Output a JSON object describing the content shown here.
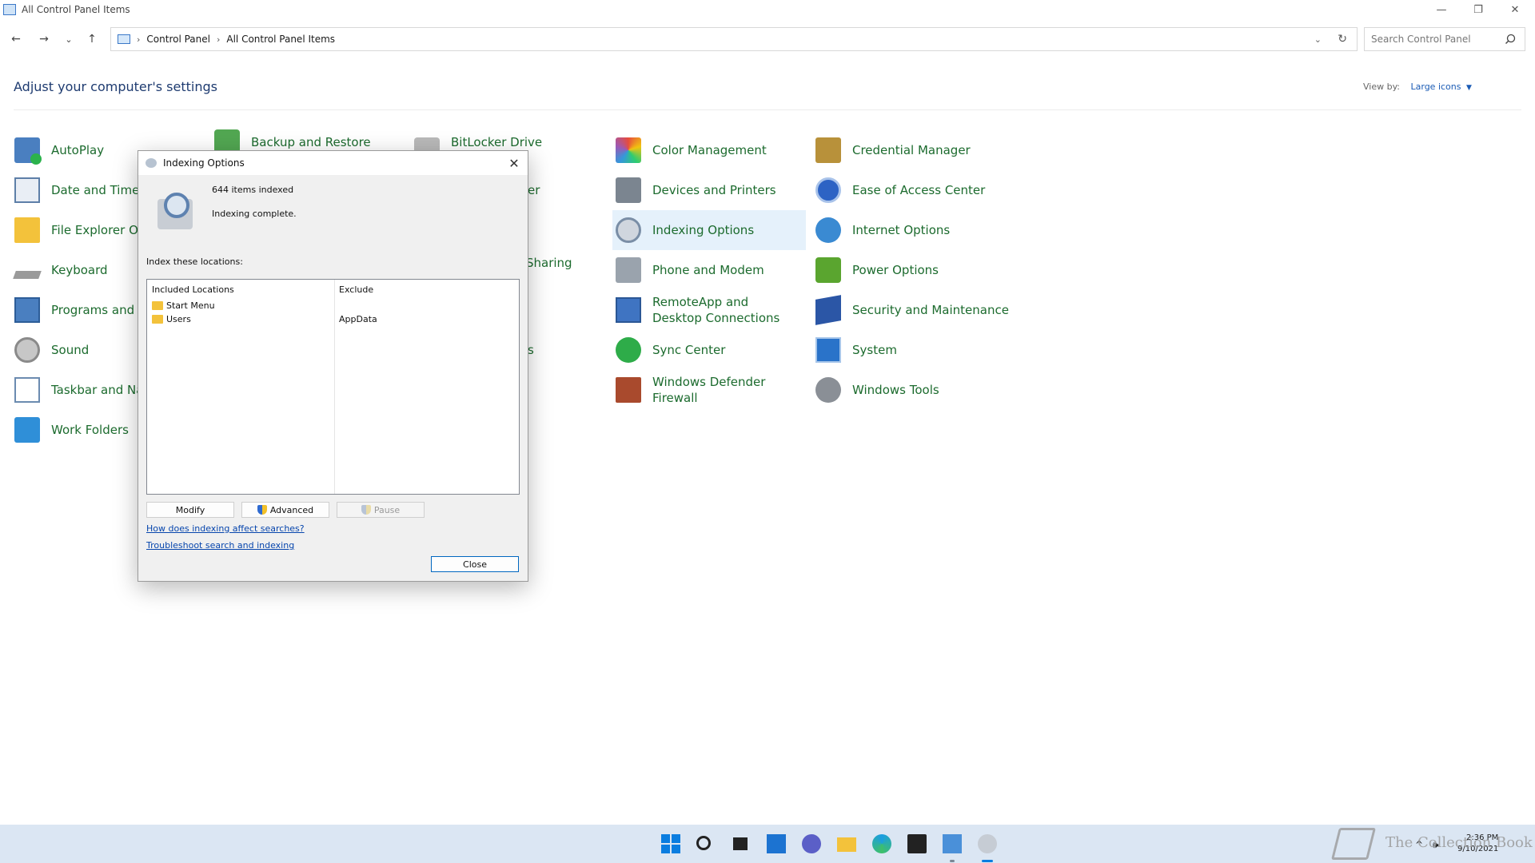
{
  "window": {
    "title": "All Control Panel Items",
    "minimize_glyph": "—",
    "restore_glyph": "❐",
    "close_glyph": "✕"
  },
  "nav": {
    "back_glyph": "←",
    "forward_glyph": "→",
    "recent_glyph": "⌄",
    "up_glyph": "↑",
    "breadcrumb": [
      "Control Panel",
      "All Control Panel Items"
    ],
    "breadcrumb_sep": "›",
    "dropdown_glyph": "⌄",
    "refresh_glyph": "↻"
  },
  "search": {
    "placeholder": "Search Control Panel"
  },
  "heading": "Adjust your computer's settings",
  "view_by": {
    "label": "View by:",
    "value": "Large icons",
    "caret": "▼"
  },
  "items": {
    "autoplay": "AutoPlay",
    "date_time": "Date and Time",
    "file_explorer": "File Explorer Op",
    "keyboard": "Keyboard",
    "programs": "Programs and F",
    "sound": "Sound",
    "taskbar": "Taskbar and Nav",
    "work_folders": "Work Folders",
    "backup": "Backup and Restore",
    "bitlocker": "BitLocker Drive Encryption",
    "partial_er": "er",
    "partial_sharing": "Sharing",
    "partial_s": "s",
    "color_mgmt": "Color Management",
    "devices": "Devices and Printers",
    "indexing": "Indexing Options",
    "phone_modem": "Phone and Modem",
    "remoteapp": "RemoteApp and Desktop Connections",
    "sync": "Sync Center",
    "firewall": "Windows Defender Firewall",
    "credential": "Credential Manager",
    "ease": "Ease of Access Center",
    "internet": "Internet Options",
    "power": "Power Options",
    "security": "Security and Maintenance",
    "system": "System",
    "tools": "Windows Tools"
  },
  "dialog": {
    "title": "Indexing Options",
    "close_glyph": "✕",
    "items_indexed": "644 items indexed",
    "status": "Indexing complete.",
    "index_label": "Index these locations:",
    "col_included": "Included Locations",
    "col_exclude": "Exclude",
    "locations": [
      {
        "name": "Start Menu",
        "exclude": ""
      },
      {
        "name": "Users",
        "exclude": "AppData"
      }
    ],
    "btn_modify": "Modify",
    "btn_advanced": "Advanced",
    "btn_pause": "Pause",
    "link_affect": "How does indexing affect searches?",
    "link_troubleshoot": "Troubleshoot search and indexing",
    "btn_close": "Close"
  },
  "taskbar": {
    "tray_up": "^",
    "tray_sound": "🕪",
    "time": "2:36 PM",
    "date": "9/10/2021",
    "watermark": "The Collection Book"
  }
}
